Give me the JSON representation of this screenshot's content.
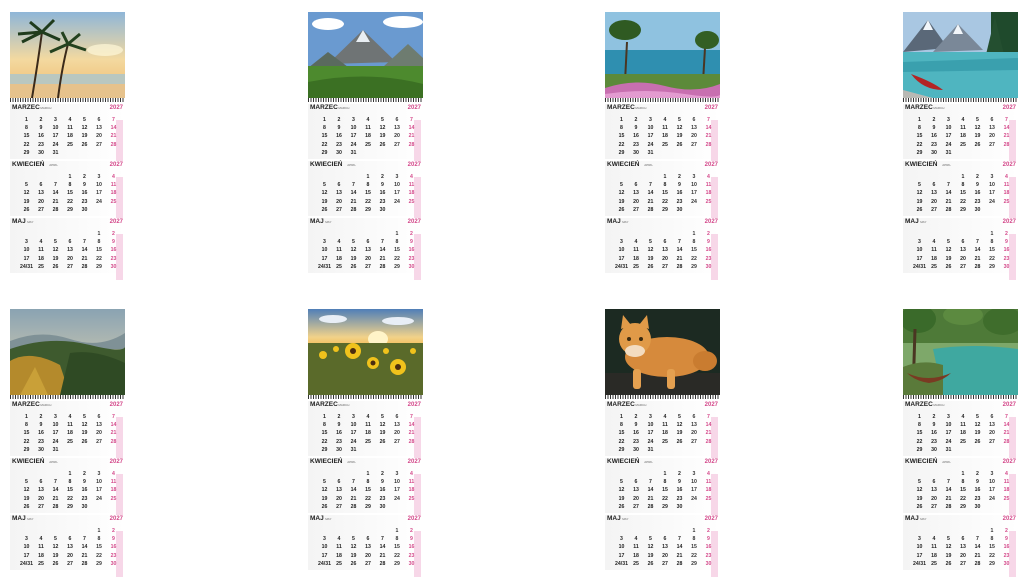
{
  "colors": {
    "sunday": "#d4488a",
    "text": "#222222",
    "stripe": "#f7d7e8"
  },
  "year": "2027",
  "weekday_headers": [
    "",
    "",
    "",
    "",
    "",
    "",
    ""
  ],
  "months": [
    {
      "pl": "MARZEC",
      "en": "MARCH",
      "rows": [
        [
          "",
          "1",
          "2",
          "3",
          "4",
          "5",
          "6",
          "7"
        ],
        [
          "",
          "8",
          "9",
          "10",
          "11",
          "12",
          "13",
          "14"
        ],
        [
          "",
          "15",
          "16",
          "17",
          "18",
          "19",
          "20",
          "21"
        ],
        [
          "",
          "22",
          "23",
          "24",
          "25",
          "26",
          "27",
          "28"
        ],
        [
          "",
          "29",
          "30",
          "31",
          "",
          "",
          "",
          ""
        ]
      ]
    },
    {
      "pl": "KWIECIEŃ",
      "en": "APRIL",
      "rows": [
        [
          "",
          "",
          "",
          "",
          "1",
          "2",
          "3",
          "4"
        ],
        [
          "",
          "5",
          "6",
          "7",
          "8",
          "9",
          "10",
          "11"
        ],
        [
          "",
          "12",
          "13",
          "14",
          "15",
          "16",
          "17",
          "18"
        ],
        [
          "",
          "19",
          "20",
          "21",
          "22",
          "23",
          "24",
          "25"
        ],
        [
          "",
          "26",
          "27",
          "28",
          "29",
          "30",
          "",
          ""
        ]
      ]
    },
    {
      "pl": "MAJ",
      "en": "MAY",
      "rows": [
        [
          "",
          "",
          "",
          "",
          "",
          "",
          "1",
          "2"
        ],
        [
          "",
          "3",
          "4",
          "5",
          "6",
          "7",
          "8",
          "9"
        ],
        [
          "",
          "10",
          "11",
          "12",
          "13",
          "14",
          "15",
          "16"
        ],
        [
          "",
          "17",
          "18",
          "19",
          "20",
          "21",
          "22",
          "23"
        ],
        [
          "",
          "24/31",
          "25",
          "26",
          "27",
          "28",
          "29",
          "30"
        ]
      ]
    }
  ],
  "calendars": [
    {
      "photo": "palm-beach-sunset"
    },
    {
      "photo": "mountain-valley"
    },
    {
      "photo": "lake-pine-flowers"
    },
    {
      "photo": "mountain-lake-canoe"
    },
    {
      "photo": "forest-hills-sunrise"
    },
    {
      "photo": "sunflower-field"
    },
    {
      "photo": "orange-cat"
    },
    {
      "photo": "forest-river-boat"
    }
  ]
}
